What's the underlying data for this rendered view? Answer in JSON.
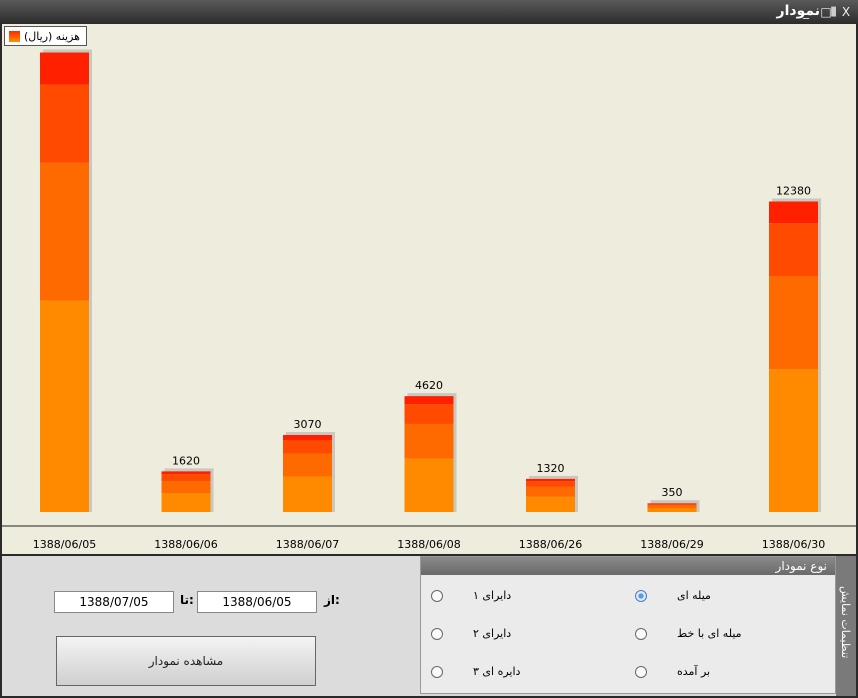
{
  "window": {
    "title": "نمودار",
    "minimize_glyph": "_",
    "maximize_glyph": "□",
    "close_glyph": "X"
  },
  "chart_data": {
    "type": "bar",
    "categories": [
      "1388/06/05",
      "1388/06/06",
      "1388/06/07",
      "1388/06/08",
      "1388/06/26",
      "1388/06/29",
      "1388/06/30"
    ],
    "values": [
      18320,
      1620,
      3070,
      4620,
      1320,
      350,
      12380
    ],
    "labels": [
      "",
      "1620",
      "3070",
      "4620",
      "1320",
      "350",
      "12380"
    ],
    "series": [
      {
        "name": "هزینه (ریال)"
      }
    ],
    "ylim": [
      0,
      18500
    ],
    "grid": false,
    "legend": "top-left",
    "colors": [
      "#ff8a00",
      "#ff6a00",
      "#ff4a00",
      "#ff2000"
    ]
  },
  "legend_label": "هزینه (ریال)",
  "filters": {
    "from_label": "از:",
    "from_value": "1388/06/05",
    "to_label": "تا:",
    "to_value": "1388/07/05",
    "show_button": "مشاهده نمودار"
  },
  "chart_type_group": {
    "title": "نوع نمودار",
    "options": [
      {
        "label": "میله ای",
        "selected": true
      },
      {
        "label": "میله ای با خط",
        "selected": false
      },
      {
        "label": "بر آمده",
        "selected": false
      },
      {
        "label": "دایرای ۱",
        "selected": false
      },
      {
        "label": "دایرای ۲",
        "selected": false
      },
      {
        "label": "دایره ای ۳",
        "selected": false
      }
    ]
  },
  "side_tab_label": "تنظیمات نمایش"
}
